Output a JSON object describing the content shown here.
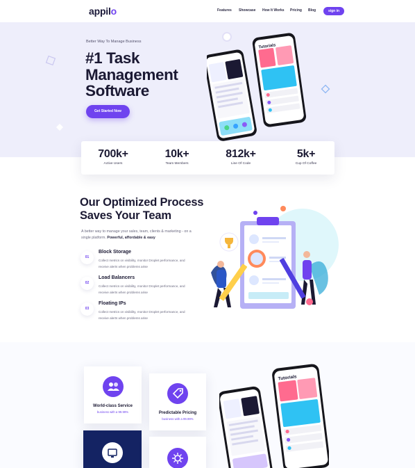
{
  "nav": {
    "logo_main": "appil",
    "logo_accent": "o",
    "links": [
      "Features",
      "Showcase",
      "How It Works",
      "Pricing",
      "Blog"
    ],
    "signin_label": "sign in"
  },
  "hero": {
    "eyebrow": "Better Way To Manage Business",
    "title": "#1 Task Management Software",
    "cta_label": "Get Started Now",
    "phone_header": "Tutorials"
  },
  "stats": [
    {
      "value": "700k+",
      "label": "Active Users"
    },
    {
      "value": "10k+",
      "label": "Team Members"
    },
    {
      "value": "812k+",
      "label": "Line Of Code"
    },
    {
      "value": "5k+",
      "label": "Cup Of Coffee"
    }
  ],
  "process": {
    "title": "Our Optimized Process Saves Your Team",
    "description": "A better way to manage your sales, team, clients & marketing - on a single platform.",
    "description_bold": "Powerful, affordable & easy",
    "steps": [
      {
        "number": "01",
        "title": "Block Storage",
        "text": "Collect metrics on visibility, monitor Droplet performance, and receive alerts when problems arise"
      },
      {
        "number": "02",
        "title": "Load Balancers",
        "text": "Collect metrics on visibility, monitor Droplet performance, and receive alerts when problems arise"
      },
      {
        "number": "03",
        "title": "Floating IPs",
        "text": "Collect metrics on visibility, monitor Droplet performance, and receive alerts when problems arise"
      }
    ]
  },
  "features": {
    "cards": [
      {
        "title": "World-class Service",
        "subtitle": "business with a 99.99%"
      },
      {
        "title": "Predictable Pricing",
        "subtitle": "business with a 99.99%"
      }
    ],
    "phone_header": "Tutorials"
  },
  "colors": {
    "accent": "#6f43ef",
    "hero_bg": "#eeeefb",
    "dark_card": "#142363",
    "heading": "#1b1933"
  }
}
